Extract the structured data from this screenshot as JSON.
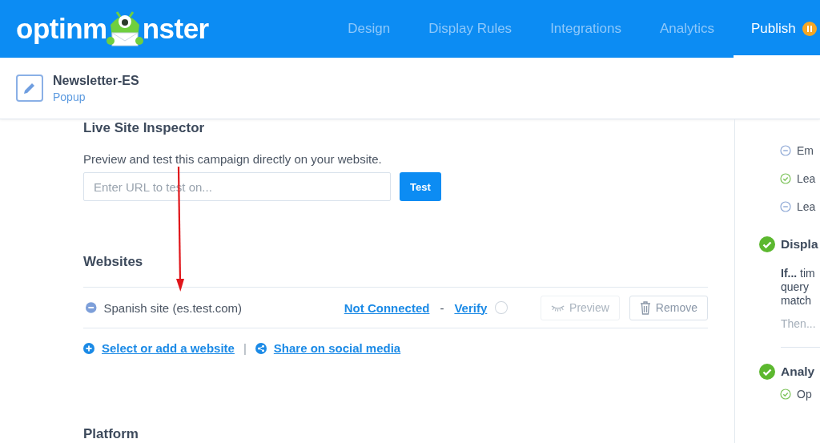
{
  "logo": {
    "text_before": "optinm",
    "text_after": "nster"
  },
  "nav": [
    {
      "label": "Design",
      "selected": false,
      "paused": false
    },
    {
      "label": "Display Rules",
      "selected": false,
      "paused": false
    },
    {
      "label": "Integrations",
      "selected": false,
      "paused": false
    },
    {
      "label": "Analytics",
      "selected": false,
      "paused": false
    },
    {
      "label": "Publish",
      "selected": true,
      "paused": true
    }
  ],
  "campaign": {
    "title": "Newsletter-ES",
    "type": "Popup"
  },
  "live_site_inspector": {
    "heading": "Live Site Inspector",
    "description": "Preview and test this campaign directly on your website.",
    "url_field": {
      "placeholder": "Enter URL to test on..."
    },
    "test_button": "Test"
  },
  "websites": {
    "heading": "Websites",
    "sites": [
      {
        "name": "Spanish site (es.test.com)",
        "status": "Not Connected",
        "separator": "-",
        "verify": "Verify",
        "verified": false,
        "preview": {
          "label": "Preview",
          "disabled": true
        },
        "remove": "Remove"
      }
    ],
    "links": [
      {
        "label": "Select or add a website",
        "kind": "add"
      },
      {
        "label": "Share on social media",
        "kind": "share"
      }
    ],
    "link_separator": "|"
  },
  "platform": {
    "heading": "Platform"
  },
  "sidebar": {
    "sections": [
      {
        "items": [
          {
            "label": "Em",
            "done": false
          },
          {
            "label": "Lea",
            "done": true
          },
          {
            "label": "Lea",
            "done": false
          }
        ]
      },
      {
        "title": "Displa",
        "done": true,
        "rule_lines": [
          "**If...** tim",
          "query",
          "match"
        ],
        "then": "Then..."
      },
      {
        "title": "Analy",
        "done": true,
        "items": [
          {
            "label": "Op",
            "done": true
          }
        ]
      }
    ]
  }
}
